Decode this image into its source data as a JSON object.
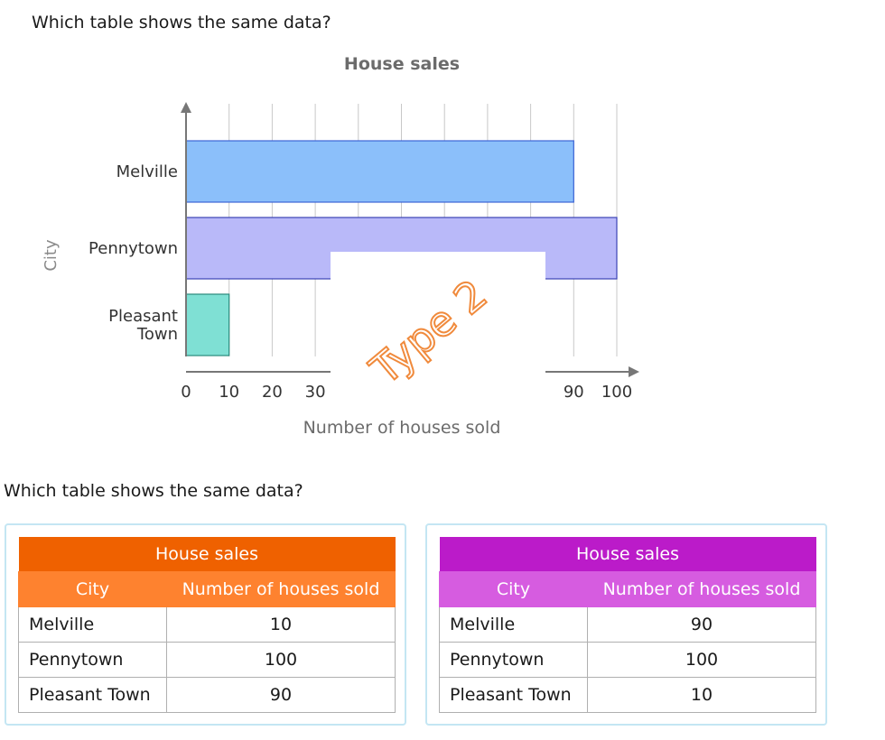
{
  "question": "Which table shows the same data?",
  "question_repeat": "Which table shows the same data?",
  "watermark": "Type 2",
  "chart_data": {
    "type": "bar",
    "orientation": "horizontal",
    "title": "House sales",
    "xlabel": "Number of houses sold",
    "ylabel": "City",
    "categories": [
      "Melville",
      "Pennytown",
      "Pleasant Town"
    ],
    "values": [
      90,
      100,
      10
    ],
    "colors": [
      "#8bbffa",
      "#b9b9f9",
      "#7fe0d4"
    ],
    "edge_colors": [
      "#3b63d6",
      "#3b43b5",
      "#2a8a7c"
    ],
    "xlim": [
      0,
      100
    ],
    "xticks": [
      0,
      10,
      20,
      30,
      40,
      50,
      60,
      70,
      80,
      90,
      100
    ],
    "xtick_labels_visible": [
      "0",
      "10",
      "20",
      "30",
      "90",
      "100"
    ],
    "grid": true
  },
  "tables": [
    {
      "title": "House sales",
      "headers": [
        "City",
        "Number of houses sold"
      ],
      "rows": [
        [
          "Melville",
          "10"
        ],
        [
          "Pennytown",
          "100"
        ],
        [
          "Pleasant Town",
          "90"
        ]
      ],
      "accent": "#ef6100"
    },
    {
      "title": "House sales",
      "headers": [
        "City",
        "Number of houses sold"
      ],
      "rows": [
        [
          "Melville",
          "90"
        ],
        [
          "Pennytown",
          "100"
        ],
        [
          "Pleasant Town",
          "10"
        ]
      ],
      "accent": "#bb1bc9"
    }
  ]
}
